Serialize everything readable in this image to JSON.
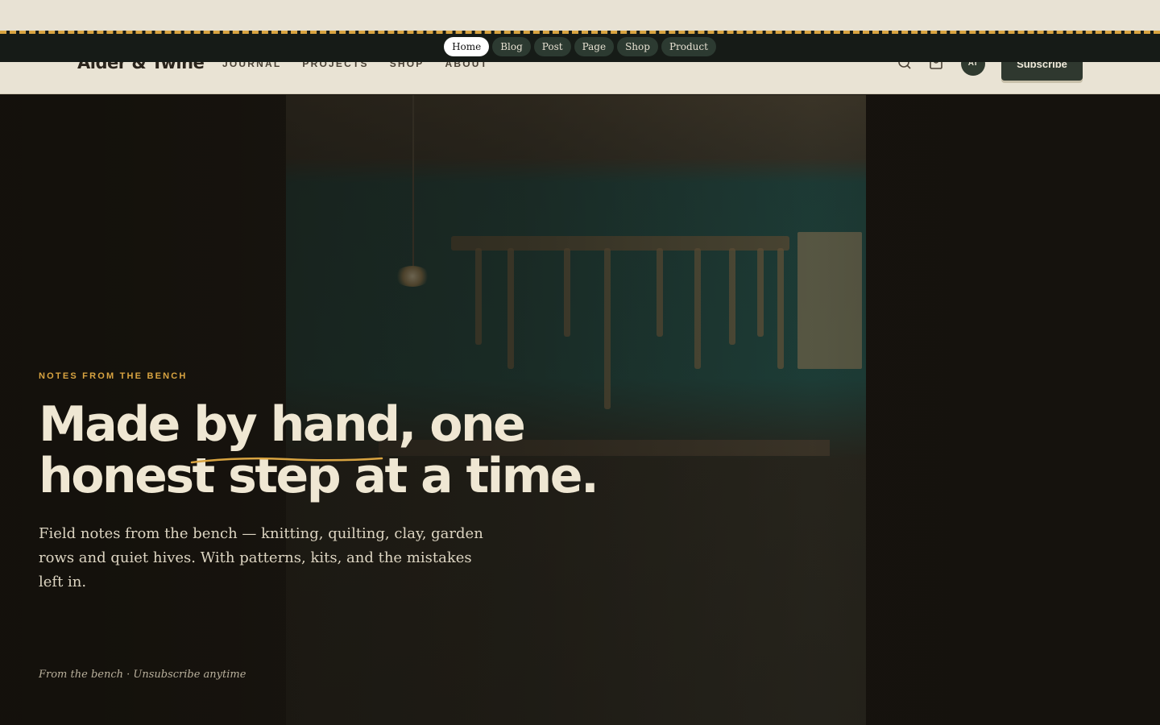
{
  "preview": {
    "tabs": [
      {
        "label": "Home",
        "active": true
      },
      {
        "label": "Blog",
        "active": false
      },
      {
        "label": "Post",
        "active": false
      },
      {
        "label": "Page",
        "active": false
      },
      {
        "label": "Shop",
        "active": false
      },
      {
        "label": "Product",
        "active": false
      }
    ]
  },
  "header": {
    "brand": "Alder & Twine",
    "nav": [
      "JOURNAL",
      "PROJECTS",
      "SHOP",
      "ABOUT"
    ],
    "avatar_initials": "AT",
    "subscribe_label": "Subscribe",
    "icons": [
      "search-icon",
      "bag-icon"
    ]
  },
  "hero": {
    "eyebrow": "NOTES FROM THE BENCH",
    "headline": "Made by hand, one honest step at a time.",
    "lede": "Field notes from the bench — knitting, quilting, clay, garden rows and quiet hives. With patterns, kits, and the mistakes left in.",
    "footnote": "From the bench · Unsubscribe anytime"
  },
  "colors": {
    "accent": "#d9a441",
    "cream": "#e9e3d4",
    "dark": "#1a1611",
    "button": "#2f382f"
  }
}
